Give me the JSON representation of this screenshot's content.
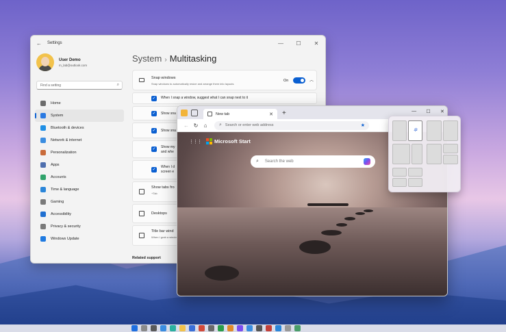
{
  "settings": {
    "window_title": "Settings",
    "user_name": "User Demo",
    "user_email": "m_lab@outlook.com",
    "search_placeholder": "Find a setting",
    "nav": [
      {
        "label": "Home",
        "color": "#6c6c6c"
      },
      {
        "label": "System",
        "color": "#2a7ae2"
      },
      {
        "label": "Bluetooth & devices",
        "color": "#1f8fe5"
      },
      {
        "label": "Network & internet",
        "color": "#3b8de0"
      },
      {
        "label": "Personalization",
        "color": "#c96b3a"
      },
      {
        "label": "Apps",
        "color": "#4e6fae"
      },
      {
        "label": "Accounts",
        "color": "#2fa36b"
      },
      {
        "label": "Time & language",
        "color": "#2b86d9"
      },
      {
        "label": "Gaming",
        "color": "#7a7a7a"
      },
      {
        "label": "Accessibility",
        "color": "#1f6fd0"
      },
      {
        "label": "Privacy & security",
        "color": "#7a7a7a"
      },
      {
        "label": "Windows Update",
        "color": "#1f7ae0"
      }
    ],
    "breadcrumb_parent": "System",
    "breadcrumb_sep": "›",
    "page_title": "Multitasking",
    "snap": {
      "title": "Snap windows",
      "desc": "Snap windows to automatically resize and arrange them into layouts",
      "state": "On"
    },
    "sub_options": [
      {
        "label": "When I snap a window, suggest what I can snap next to it"
      },
      {
        "label": "Show sna"
      },
      {
        "label": "Show sna"
      },
      {
        "label": "Show my\nand whe"
      },
      {
        "label": "When I d\nscreen e"
      }
    ],
    "rows": [
      {
        "label": "Show tabs fro",
        "sub": "+Tab"
      },
      {
        "label": "Desktops",
        "sub": ""
      },
      {
        "label": "Title bar wind",
        "sub": "When I grab a window's..."
      }
    ],
    "related": "Related support"
  },
  "browser": {
    "tab_title": "New tab",
    "address_placeholder": "Search or enter web address",
    "brand": "Microsoft Start",
    "search_placeholder": "Search the web"
  },
  "colors": {
    "accent": "#0a5fd1"
  }
}
